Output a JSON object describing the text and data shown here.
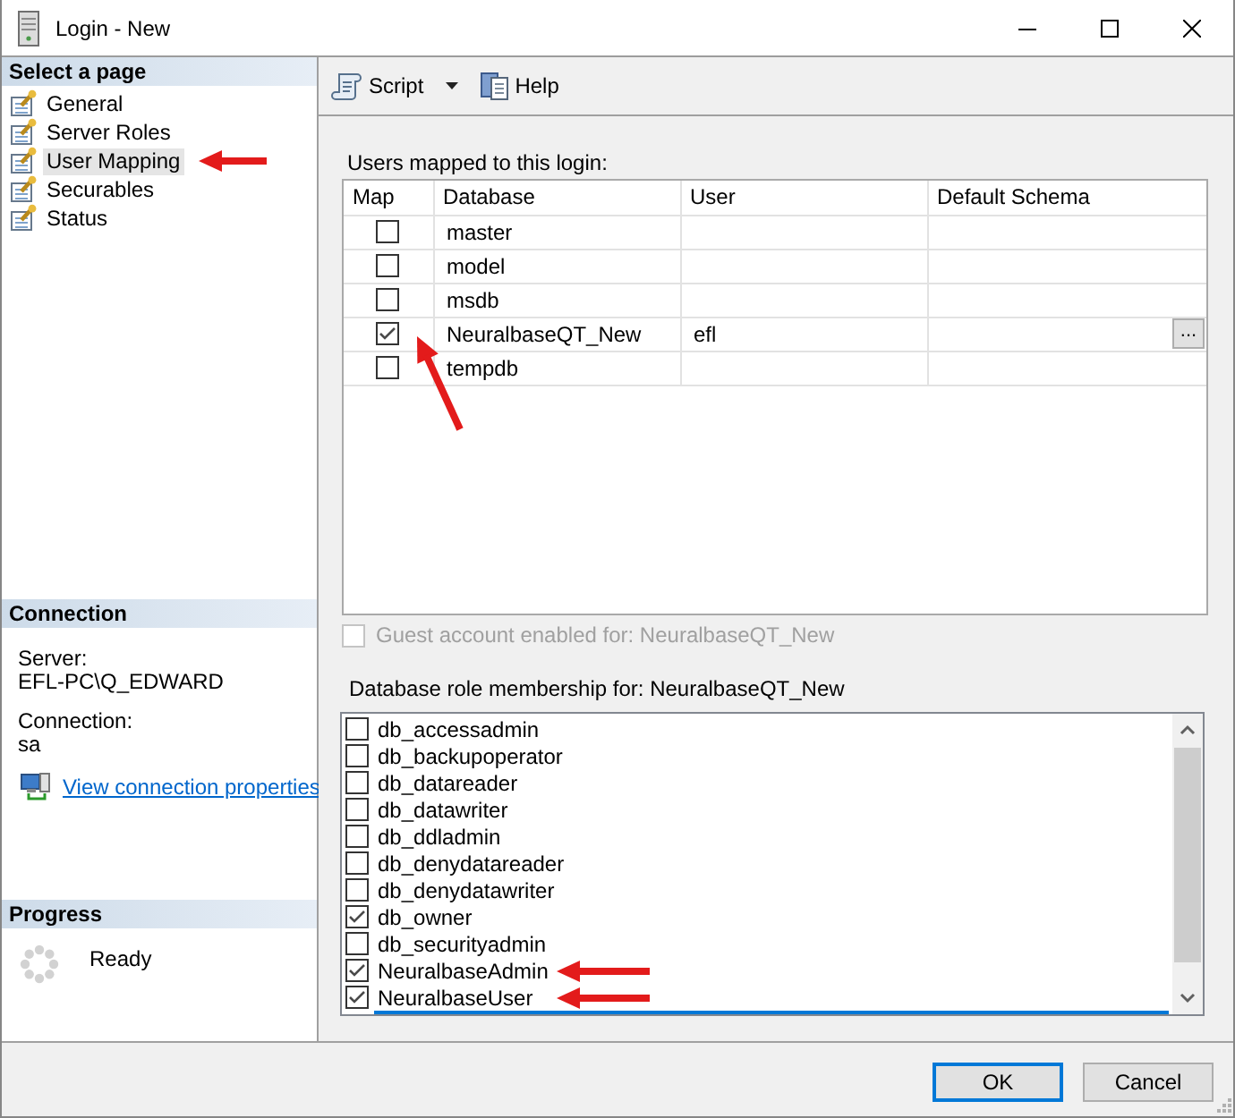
{
  "window": {
    "title": "Login - New"
  },
  "sidebar": {
    "pages": {
      "header": "Select a page",
      "items": [
        {
          "label": "General",
          "selected": false,
          "annotated": false
        },
        {
          "label": "Server Roles",
          "selected": false,
          "annotated": false
        },
        {
          "label": "User Mapping",
          "selected": true,
          "annotated": true
        },
        {
          "label": "Securables",
          "selected": false,
          "annotated": false
        },
        {
          "label": "Status",
          "selected": false,
          "annotated": false
        }
      ]
    },
    "connection": {
      "header": "Connection",
      "server_label": "Server:",
      "server": "EFL-PC\\Q_EDWARD",
      "connection_label": "Connection:",
      "connection": "sa",
      "link": "View connection properties"
    },
    "progress": {
      "header": "Progress",
      "status": "Ready"
    }
  },
  "toolbar": [
    {
      "kind": "dropdown",
      "label": "Script"
    },
    {
      "kind": "button",
      "label": "Help"
    }
  ],
  "users_mapped": {
    "label": "Users mapped to this login:",
    "columns": [
      "Map",
      "Database",
      "User",
      "Default Schema"
    ],
    "rows": [
      {
        "checked": false,
        "database": "master",
        "annotated": false
      },
      {
        "checked": false,
        "database": "model",
        "annotated": false
      },
      {
        "checked": false,
        "database": "msdb",
        "annotated": false
      },
      {
        "checked": true,
        "database": "NeuralbaseQT_New",
        "user": "efl",
        "browse": "...",
        "annotated": true
      },
      {
        "checked": false,
        "database": "tempdb",
        "annotated": false
      }
    ]
  },
  "guest": {
    "label": "Guest account enabled for: NeuralbaseQT_New",
    "checked": false,
    "disabled": true
  },
  "roles": {
    "label": "Database role membership for: NeuralbaseQT_New",
    "items": [
      {
        "name": "db_accessadmin",
        "checked": false,
        "annotated": false
      },
      {
        "name": "db_backupoperator",
        "checked": false,
        "annotated": false
      },
      {
        "name": "db_datareader",
        "checked": false,
        "annotated": false
      },
      {
        "name": "db_datawriter",
        "checked": false,
        "annotated": false
      },
      {
        "name": "db_ddladmin",
        "checked": false,
        "annotated": false
      },
      {
        "name": "db_denydatareader",
        "checked": false,
        "annotated": false
      },
      {
        "name": "db_denydatawriter",
        "checked": false,
        "annotated": false
      },
      {
        "name": "db_owner",
        "checked": true,
        "annotated": false
      },
      {
        "name": "db_securityadmin",
        "checked": false,
        "annotated": false
      },
      {
        "name": "NeuralbaseAdmin",
        "checked": true,
        "annotated": true
      },
      {
        "name": "NeuralbaseUser",
        "checked": true,
        "annotated": true
      }
    ]
  },
  "buttons": [
    {
      "label": "OK",
      "default": true
    },
    {
      "label": "Cancel",
      "default": false
    }
  ]
}
